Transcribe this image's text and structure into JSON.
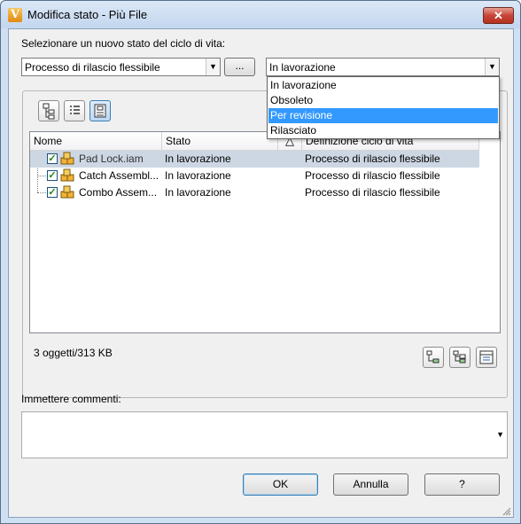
{
  "window": {
    "title": "Modifica stato - Più File",
    "app_icon_letter": "V",
    "close_label": "✕"
  },
  "select_label": "Selezionare un nuovo stato del ciclo di vita:",
  "lifecycle_combo": {
    "value": "Processo di rilascio flessibile",
    "browse_label": "..."
  },
  "state_combo": {
    "value": "In lavorazione",
    "options": [
      "In lavorazione",
      "Obsoleto",
      "Per revisione",
      "Rilasciato"
    ],
    "highlighted": "Per revisione"
  },
  "table": {
    "columns": [
      "Nome",
      "Stato",
      "",
      "Definizione ciclo di vita"
    ],
    "sort_indicator": "△",
    "rows": [
      {
        "name": "Pad Lock.iam",
        "state": "In lavorazione",
        "definition": "Processo di rilascio flessibile",
        "checked": true,
        "selected": true
      },
      {
        "name": "Catch Assembl...",
        "state": "In lavorazione",
        "definition": "Processo di rilascio flessibile",
        "checked": true,
        "selected": false
      },
      {
        "name": "Combo Assem...",
        "state": "In lavorazione",
        "definition": "Processo di rilascio flessibile",
        "checked": true,
        "selected": false
      }
    ]
  },
  "summary": "3 oggetti/313 KB",
  "comments_label": "Immettere commenti:",
  "comments_value": "",
  "buttons": {
    "ok": "OK",
    "cancel": "Annulla",
    "help": "?"
  },
  "colors": {
    "accent": "#3399ff",
    "selected_row": "#cdd7e3",
    "titlebar": "#c3d6ee",
    "close": "#c6453a"
  }
}
